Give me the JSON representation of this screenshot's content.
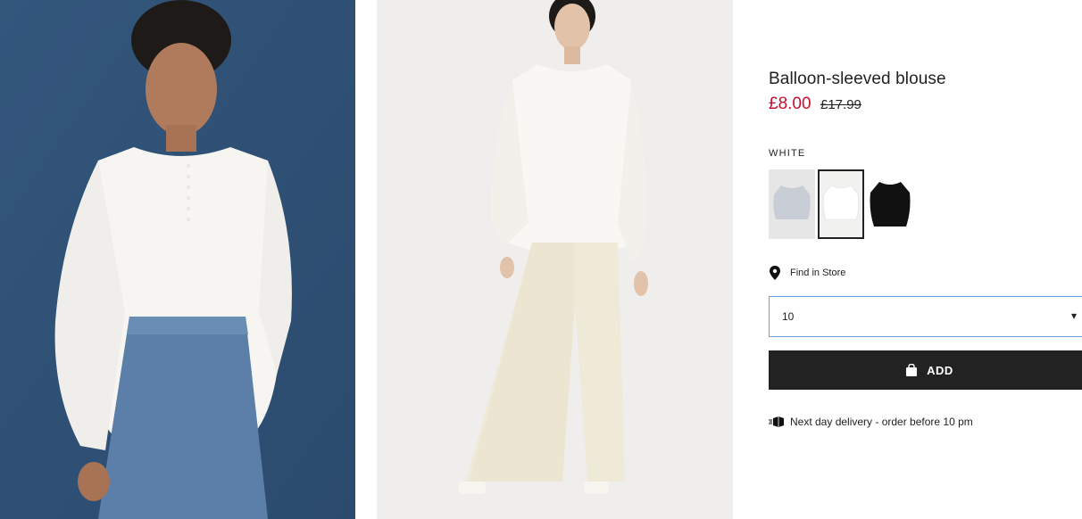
{
  "product": {
    "title": "Balloon-sleeved blouse",
    "sale_price": "£8.00",
    "original_price": "£17.99",
    "color_label": "WHITE",
    "swatches": [
      {
        "name": "light-grey"
      },
      {
        "name": "white",
        "selected": true
      },
      {
        "name": "black"
      }
    ],
    "find_in_store": "Find in Store",
    "size_value": "10",
    "add_button": "ADD",
    "delivery_text": "Next day delivery - order before 10 pm"
  },
  "colors": {
    "sale": "#c8102e",
    "button_bg": "#222222",
    "select_border": "#6fa2d9"
  },
  "icons": {
    "pin": "map-pin-icon",
    "bag": "shopping-bag-icon",
    "truck": "delivery-truck-icon",
    "chevron": "chevron-down-icon"
  }
}
